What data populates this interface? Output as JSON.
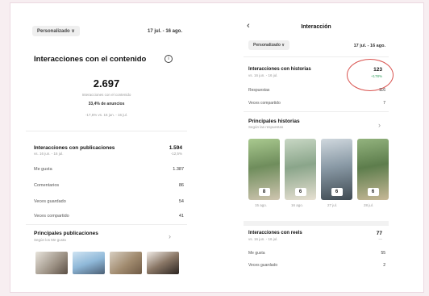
{
  "left": {
    "filter_label": "Personalizado ∨",
    "date_range": "17 jul. - 16 ago.",
    "section_title": "Interacciones con el contenido",
    "info_icon": "info-icon",
    "total_value": "2.697",
    "total_caption": "Interacciones con el contenido",
    "ads_note": "33,4% de anuncios",
    "compare_note": "-17,6% vs. 16 jun. - 16 jul.",
    "posts": {
      "title": "Interacciones con publicaciones",
      "subtitle": "vs. 16 jun. - 16 jul.",
      "value": "1.594",
      "delta": "-12,5%",
      "rows": [
        {
          "label": "Me gusta",
          "value": "1.387"
        },
        {
          "label": "Comentarios",
          "value": "86"
        },
        {
          "label": "Veces guardado",
          "value": "54"
        },
        {
          "label": "Veces compartido",
          "value": "41"
        }
      ]
    },
    "top_posts": {
      "title": "Principales publicaciones",
      "subtitle": "Según los Me gusta"
    }
  },
  "right": {
    "back_icon": "back-arrow-icon",
    "screen_title": "Interacción",
    "filter_label": "Personalizado ∨",
    "date_range": "17 jul. - 16 ago.",
    "stories": {
      "title": "Interacciones con historias",
      "subtitle": "vs. 16 jun. - 16 jul.",
      "value": "123",
      "delta": "+178%",
      "rows": [
        {
          "label": "Respuestas",
          "value": "116"
        },
        {
          "label": "Veces compartido",
          "value": "7"
        }
      ]
    },
    "top_stories": {
      "title": "Principales historias",
      "subtitle": "Según las respuestas",
      "items": [
        {
          "count": "8",
          "date": "15 ago."
        },
        {
          "count": "6",
          "date": "16 ago."
        },
        {
          "count": "6",
          "date": "27 jul."
        },
        {
          "count": "6",
          "date": "28 jul."
        }
      ]
    },
    "reels": {
      "title": "Interacciones con reels",
      "subtitle": "vs. 16 jun. - 16 jul.",
      "value": "77",
      "delta": "—",
      "rows": [
        {
          "label": "Me gusta",
          "value": "55"
        },
        {
          "label": "Veces guardado",
          "value": "2"
        }
      ]
    }
  },
  "colors": {
    "accent_green": "#2e9e5b",
    "annotation_red": "#d9534f"
  }
}
